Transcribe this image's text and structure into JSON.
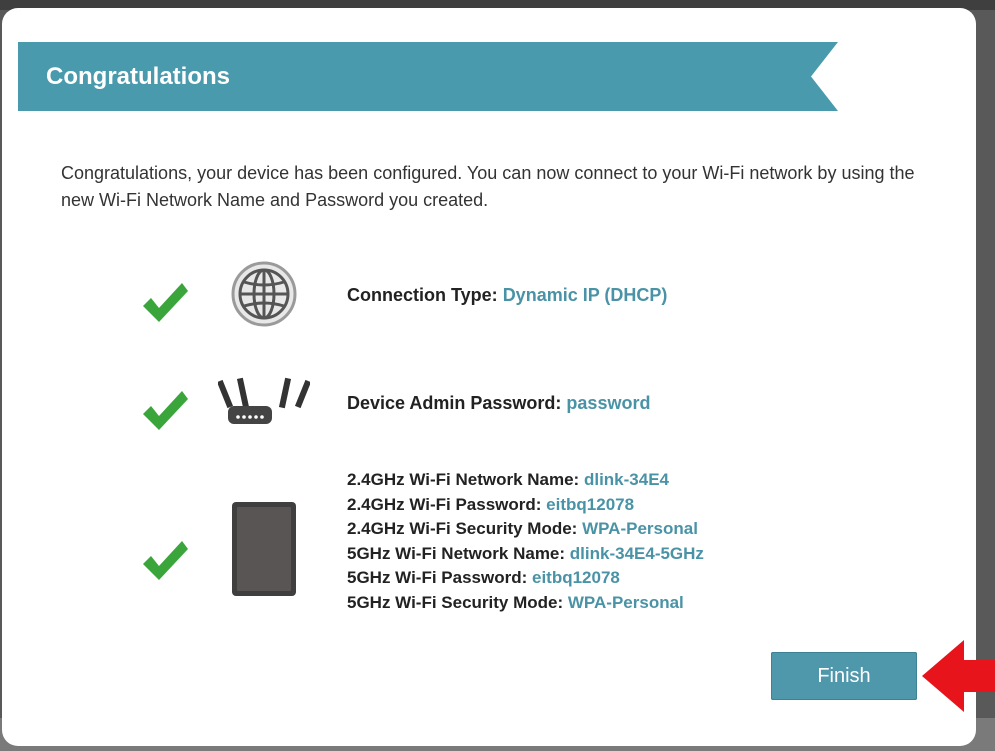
{
  "banner": {
    "title": "Congratulations"
  },
  "intro": "Congratulations, your device has been configured. You can now connect to your Wi-Fi network by using the new Wi-Fi Network Name and Password you created.",
  "connection": {
    "label": "Connection Type:",
    "value": "Dynamic IP (DHCP)"
  },
  "admin": {
    "label": "Device Admin Password:",
    "value": "password"
  },
  "wifi": [
    {
      "label": "2.4GHz Wi-Fi Network Name:",
      "value": "dlink-34E4"
    },
    {
      "label": "2.4GHz Wi-Fi Password:",
      "value": "eitbq12078"
    },
    {
      "label": "2.4GHz Wi-Fi Security Mode:",
      "value": "WPA-Personal"
    },
    {
      "label": "5GHz Wi-Fi Network Name:",
      "value": "dlink-34E4-5GHz"
    },
    {
      "label": "5GHz Wi-Fi Password:",
      "value": "eitbq12078"
    },
    {
      "label": "5GHz Wi-Fi Security Mode:",
      "value": "WPA-Personal"
    }
  ],
  "buttons": {
    "finish": "Finish"
  },
  "icons": {
    "check": "checkmark-icon",
    "globe": "globe-icon",
    "router": "router-icon",
    "device": "tablet-icon",
    "pointer": "red-arrow-pointer"
  },
  "colors": {
    "banner": "#4a9aad",
    "value": "#4a93a6",
    "check": "#3aa53a",
    "button": "#4f97ab",
    "pointer": "#e8141b"
  }
}
